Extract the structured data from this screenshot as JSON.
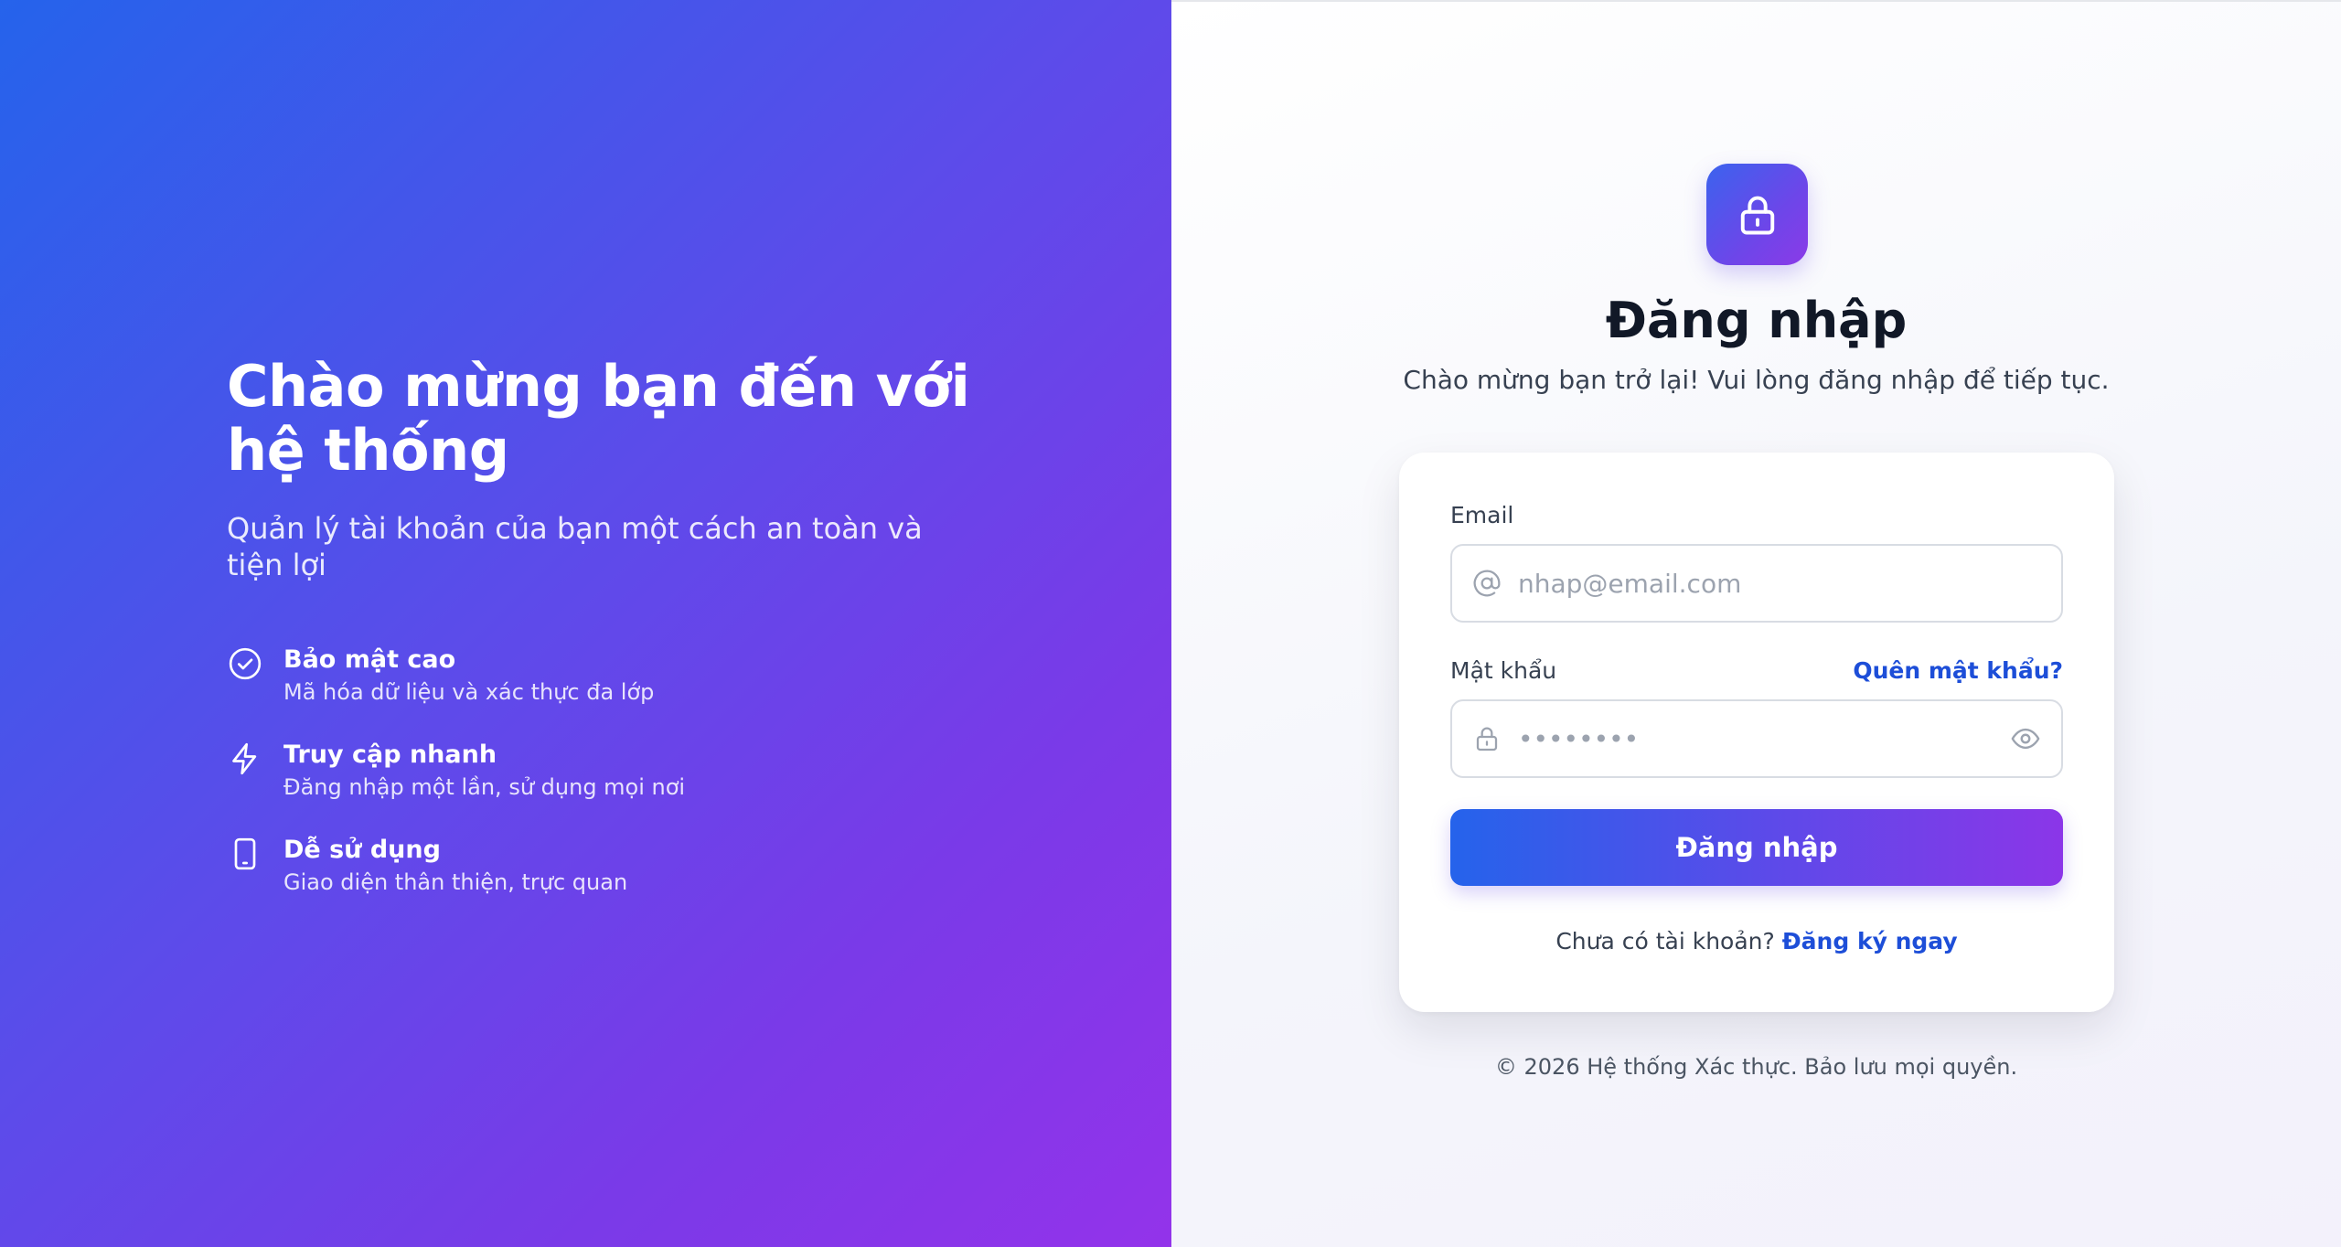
{
  "hero": {
    "title_line1": "Chào mừng bạn đến với",
    "title_line2": "hệ thống",
    "subtitle": "Quản lý tài khoản của bạn một cách an toàn và tiện lợi",
    "features": [
      {
        "icon": "check-circle-icon",
        "title": "Bảo mật cao",
        "desc": "Mã hóa dữ liệu và xác thực đa lớp"
      },
      {
        "icon": "lightning-icon",
        "title": "Truy cập nhanh",
        "desc": "Đăng nhập một lần, sử dụng mọi nơi"
      },
      {
        "icon": "smartphone-icon",
        "title": "Dễ sử dụng",
        "desc": "Giao diện thân thiện, trực quan"
      }
    ],
    "gradient_start": "#2563eb",
    "gradient_end": "#9333ea"
  },
  "auth": {
    "badge_icon": "lock-icon",
    "title": "Đăng nhập",
    "subtitle": "Chào mừng bạn trở lại! Vui lòng đăng nhập để tiếp tục.",
    "form": {
      "email_label": "Email",
      "email_placeholder": "nhap@email.com",
      "email_value": "",
      "password_label": "Mật khẩu",
      "forgot_label": "Quên mật khẩu?",
      "password_placeholder": "••••••••",
      "password_value": "",
      "submit_label": "Đăng nhập",
      "signup_prompt": "Chưa có tài khoản?",
      "signup_link": "Đăng ký ngay"
    },
    "footer": "© 2026 Hệ thống Xác thực. Bảo lưu mọi quyền.",
    "accent_color": "#1d4ed8"
  }
}
